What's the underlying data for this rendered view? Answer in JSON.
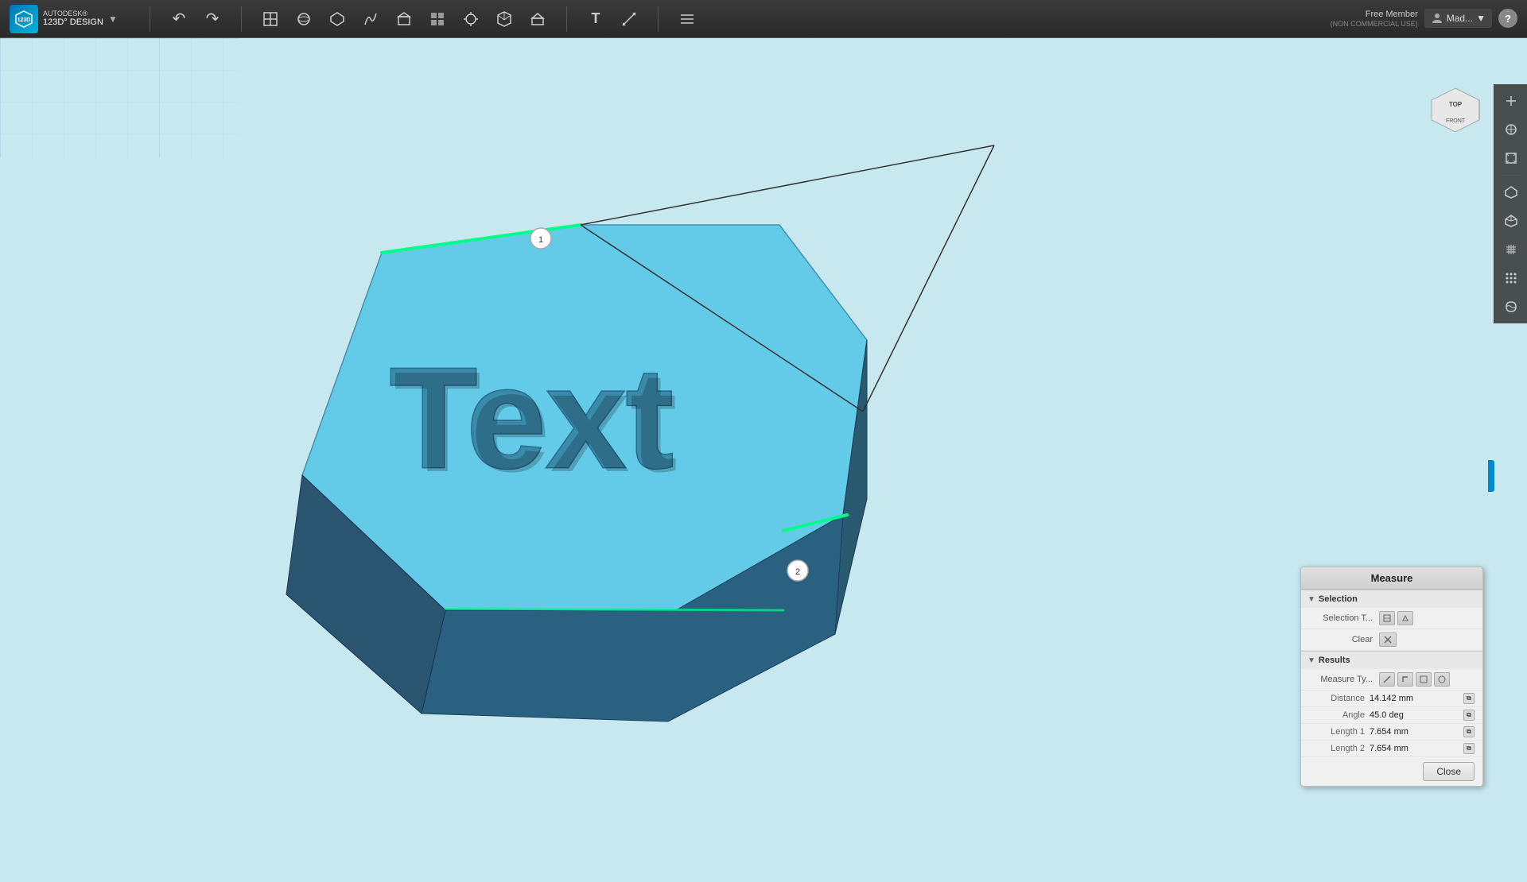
{
  "app": {
    "brand": "AUTODESK®",
    "name": "123D° DESIGN",
    "user": "Mad...",
    "membership": "Free Member",
    "membership_sub": "(NON COMMERCIAL USE)",
    "help_label": "?"
  },
  "toolbar": {
    "undo_label": "↶",
    "redo_label": "↷",
    "separator": "|"
  },
  "nav_cube": {
    "top_label": "TOP",
    "front_label": "FRONT"
  },
  "measure_panel": {
    "title": "Measure",
    "selection_section": "Selection",
    "selection_type_label": "Selection T...",
    "clear_label": "Clear",
    "results_section": "Results",
    "measure_type_label": "Measure Ty...",
    "distance_label": "Distance",
    "distance_value": "14.142 mm",
    "angle_label": "Angle",
    "angle_value": "45.0 deg",
    "length1_label": "Length 1",
    "length1_value": "7.654 mm",
    "length2_label": "Length 2",
    "length2_value": "7.654 mm",
    "close_label": "Close"
  },
  "viewport": {
    "point1_label": "1",
    "point2_label": "2",
    "shape_color": "#5bc8e8",
    "edge_color": "#00ff88"
  }
}
